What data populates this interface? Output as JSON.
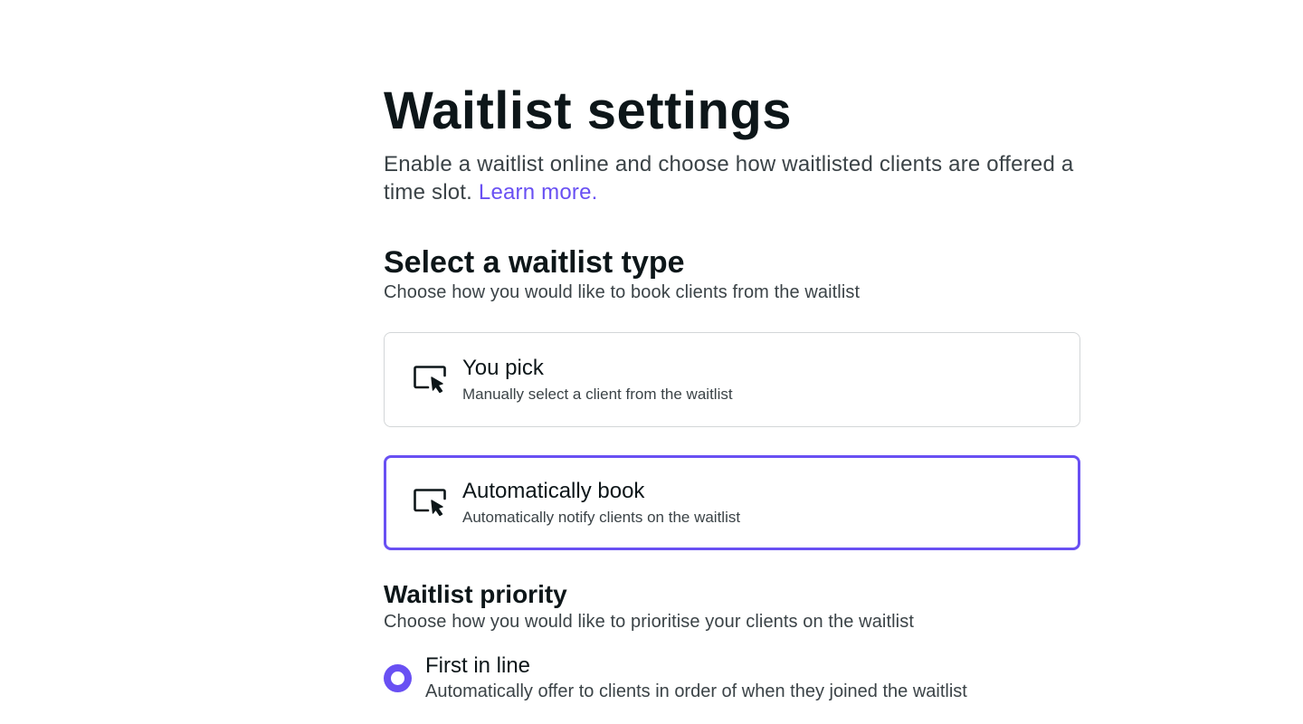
{
  "header": {
    "title": "Waitlist settings",
    "description": "Enable a waitlist online and choose how waitlisted clients are offered a time slot.",
    "learn_more": "Learn more."
  },
  "waitlist_type": {
    "title": "Select a waitlist type",
    "description": "Choose how you would like to book clients from the waitlist",
    "options": [
      {
        "title": "You pick",
        "subtitle": "Manually select a client from the waitlist",
        "icon": "screen-cursor-icon",
        "selected": false
      },
      {
        "title": "Automatically book",
        "subtitle": "Automatically notify clients on the waitlist",
        "icon": "screen-cursor-icon",
        "selected": true
      }
    ]
  },
  "priority": {
    "title": "Waitlist priority",
    "description": "Choose how you would like to prioritise your clients on the waitlist",
    "options": [
      {
        "title": "First in line",
        "subtitle": "Automatically offer to clients in order of when they joined the waitlist",
        "selected": true
      }
    ]
  },
  "colors": {
    "accent": "#6950f3",
    "text_primary": "#0d1619",
    "text_secondary": "#3b4347",
    "border": "#d3d6d8"
  }
}
